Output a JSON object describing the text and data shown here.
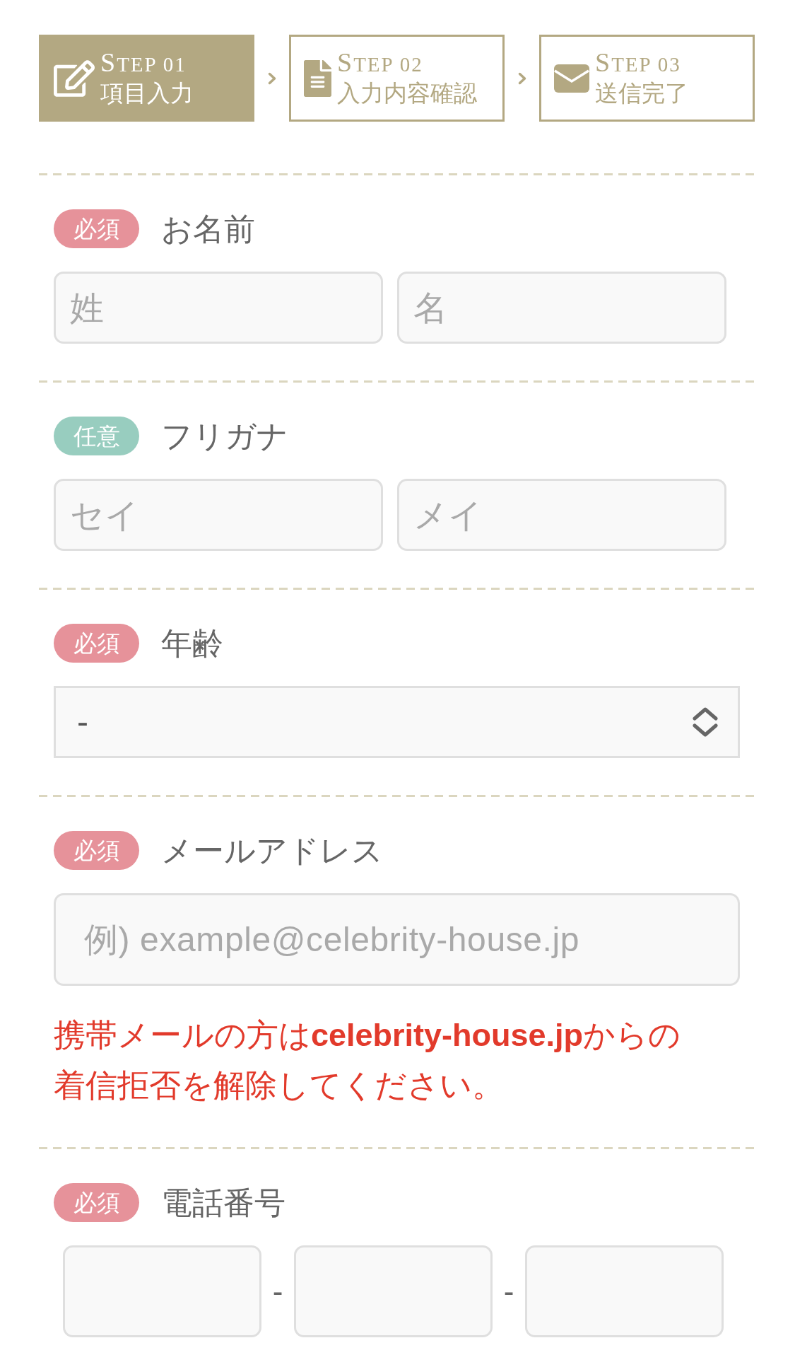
{
  "steps": [
    {
      "label": "STEP 01",
      "title": "項目入力",
      "selected": true
    },
    {
      "label": "STEP 02",
      "title": "入力内容確認",
      "selected": false
    },
    {
      "label": "STEP 03",
      "title": "送信完了",
      "selected": false
    }
  ],
  "fields": [
    {
      "kind": "pair",
      "badge": {
        "text": "必須",
        "color": "#e6929a"
      },
      "label": "お名前",
      "inputs": [
        {
          "placeholder": "姓"
        },
        {
          "placeholder": "名"
        }
      ]
    },
    {
      "kind": "pair",
      "badge": {
        "text": "任意",
        "color": "#98cdbf"
      },
      "label": "フリガナ",
      "inputs": [
        {
          "placeholder": "セイ"
        },
        {
          "placeholder": "メイ"
        }
      ]
    },
    {
      "kind": "select",
      "badge": {
        "text": "必須",
        "color": "#e6929a"
      },
      "label": "年齢",
      "value": "-"
    },
    {
      "kind": "single",
      "badge": {
        "text": "必須",
        "color": "#e6929a"
      },
      "label": "メールアドレス",
      "inputs": [
        {
          "placeholder": "例) example@celebrity-house.jp"
        }
      ],
      "note": "携帯メールの方は**celebrity-house.jp**からの着信拒否を解除してください。"
    },
    {
      "kind": "tel",
      "badge": {
        "text": "必須",
        "color": "#e6929a"
      },
      "label": "電話番号",
      "parts": [
        {
          "kind": "input"
        },
        {
          "kind": "separator",
          "text": "-"
        },
        {
          "kind": "input"
        },
        {
          "kind": "separator",
          "text": "-"
        },
        {
          "kind": "input"
        }
      ]
    }
  ]
}
